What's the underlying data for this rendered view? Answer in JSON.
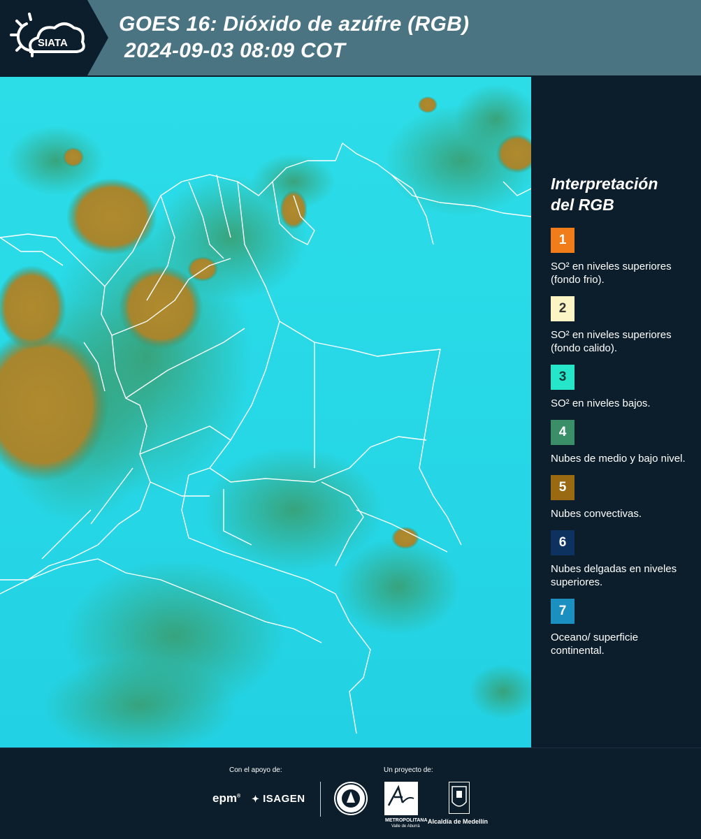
{
  "header": {
    "logo_text": "SIATA",
    "title_line1": "GOES 16: Dióxido de azúfre (RGB)",
    "title_line2": "2024-09-03 08:09 COT"
  },
  "legend": {
    "title_line1": "Interpretación",
    "title_line2": "del RGB",
    "items": [
      {
        "number": "1",
        "color": "#f07d1a",
        "text_color": "#ffffff",
        "label": "SO² en niveles superiores (fondo frio)."
      },
      {
        "number": "2",
        "color": "#fbf5c6",
        "text_color": "#333333",
        "label": "SO² en niveles superiores (fondo calido)."
      },
      {
        "number": "3",
        "color": "#25e6c9",
        "text_color": "#0c3a3a",
        "label": "SO² en niveles bajos."
      },
      {
        "number": "4",
        "color": "#3a8f68",
        "text_color": "#ffffff",
        "label": "Nubes de medio y bajo nivel."
      },
      {
        "number": "5",
        "color": "#9a6a12",
        "text_color": "#ffffff",
        "label": "Nubes convectivas."
      },
      {
        "number": "6",
        "color": "#0e3260",
        "text_color": "#ffffff",
        "label": "Nubes delgadas en niveles superiores."
      },
      {
        "number": "7",
        "color": "#1b8fc0",
        "text_color": "#ffffff",
        "label": "Oceano/ superficie continental."
      }
    ]
  },
  "map": {
    "colors": {
      "background": "#27dde6",
      "green_cloud": "#3a9a6a",
      "convective": "#b08a2e",
      "border": "#ffffff"
    }
  },
  "footer": {
    "support_label": "Con el apoyo de:",
    "project_label": "Un proyecto de:",
    "sponsor_epm": "epm",
    "sponsor_isagen": "ISAGEN",
    "area_caption": "METROPOLITANA",
    "area_sub": "Valle de Aburrá",
    "alcaldia": "Alcaldía de Medellín"
  }
}
